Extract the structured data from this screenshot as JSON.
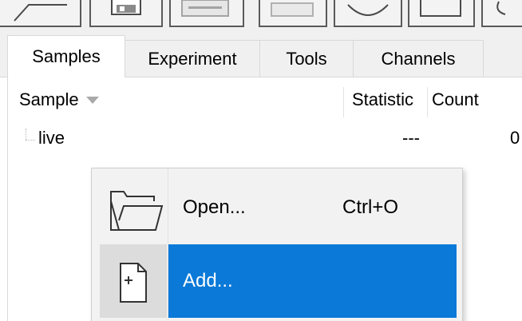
{
  "toolbar": {
    "buttons": [
      {
        "icon": "open-folder-icon"
      },
      {
        "icon": "save-icon"
      },
      {
        "icon": "export-icon"
      },
      {
        "icon": "blank-icon"
      },
      {
        "icon": "circle-gate-icon"
      },
      {
        "icon": "rectangle-gate-icon"
      },
      {
        "icon": "polygon-gate-icon"
      }
    ]
  },
  "tabs": [
    {
      "label": "Samples",
      "active": true
    },
    {
      "label": "Experiment",
      "active": false
    },
    {
      "label": "Tools",
      "active": false
    },
    {
      "label": "Channels",
      "active": false
    }
  ],
  "sample_list": {
    "columns": {
      "sample": "Sample",
      "statistic": "Statistic",
      "count": "Count"
    },
    "rows": [
      {
        "sample": "live",
        "statistic": "---",
        "count": "0"
      }
    ]
  },
  "context_menu": {
    "items": [
      {
        "label": "Open...",
        "shortcut": "Ctrl+O",
        "icon": "folder-open-icon",
        "highlighted": false
      },
      {
        "label": "Add...",
        "shortcut": "",
        "icon": "add-file-icon",
        "highlighted": true
      }
    ]
  },
  "colors": {
    "highlight": "#0a79d8",
    "chrome": "#f0f0f0",
    "menu_bg": "#f2f2f2"
  }
}
